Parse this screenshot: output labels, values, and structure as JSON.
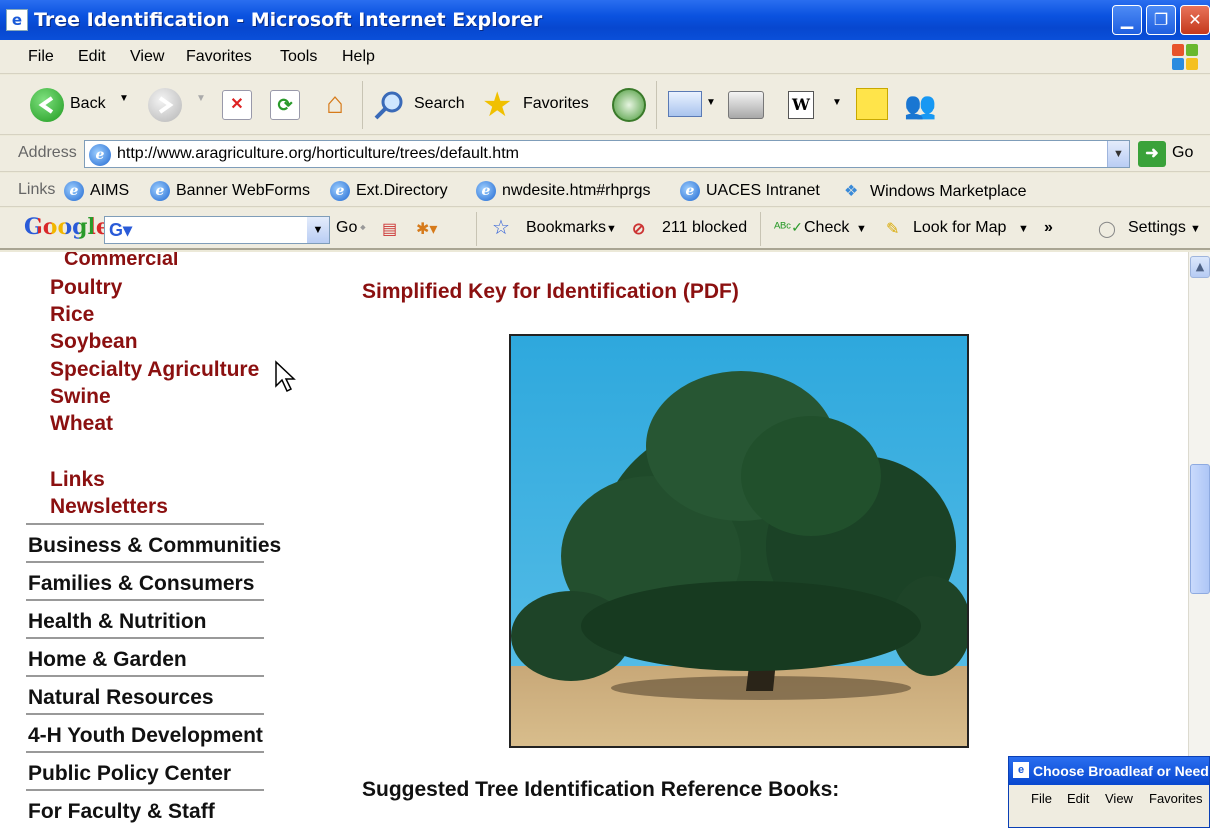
{
  "window": {
    "title": "Tree Identification - Microsoft Internet Explorer"
  },
  "menu": {
    "items": [
      "File",
      "Edit",
      "View",
      "Favorites",
      "Tools",
      "Help"
    ]
  },
  "toolbar": {
    "back_label": "Back",
    "search_label": "Search",
    "favorites_label": "Favorites"
  },
  "address": {
    "label": "Address",
    "url": "http://www.aragriculture.org/horticulture/trees/default.htm",
    "go_label": "Go"
  },
  "links": {
    "label": "Links",
    "items": [
      "AIMS",
      "Banner WebForms",
      "Ext.Directory",
      "nwdesite.htm#rhprgs",
      "UACES Intranet",
      "Windows Marketplace"
    ]
  },
  "google": {
    "logo": "Google",
    "go_label": "Go",
    "bookmarks_label": "Bookmarks",
    "blocked_label": "211 blocked",
    "check_label": "Check",
    "map_label": "Look for Map",
    "settings_label": "Settings"
  },
  "sidebar": {
    "sub_items": [
      "Commercial",
      "Poultry",
      "Rice",
      "Soybean",
      "Specialty Agriculture",
      "Swine",
      "Wheat",
      "Links",
      "Newsletters"
    ],
    "main_items": [
      "Business & Communities",
      "Families & Consumers",
      "Health & Nutrition",
      "Home & Garden",
      "Natural Resources",
      "4-H Youth Development",
      "Public Policy Center",
      "For Faculty & Staff"
    ]
  },
  "main": {
    "pdf_link": "Simplified Key for Identification (PDF)",
    "books_heading": "Suggested Tree Identification Reference Books:"
  },
  "popup": {
    "title": "Choose Broadleaf or Needle",
    "menu": [
      "File",
      "Edit",
      "View",
      "Favorites"
    ]
  }
}
